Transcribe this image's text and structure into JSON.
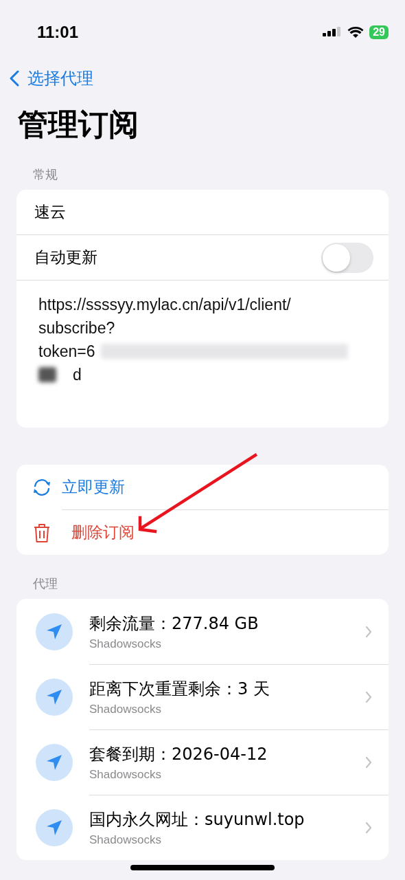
{
  "status_bar": {
    "time": "11:01",
    "battery": "29"
  },
  "nav": {
    "back_label": "选择代理",
    "title": "管理订阅"
  },
  "general": {
    "header": "常规",
    "name": "速云",
    "auto_update": {
      "label": "自动更新",
      "on": false
    },
    "url_lines": [
      {
        "text": "https://ssssyy.mylac.cn/api/v1/client/"
      },
      {
        "text": "subscribe?"
      },
      {
        "text": "token=6",
        "redacted_after": true
      },
      {
        "text": "d",
        "redacted_before": true
      }
    ]
  },
  "actions": [
    {
      "kind": "refresh",
      "label": "立即更新"
    },
    {
      "kind": "delete",
      "label": "删除订阅"
    }
  ],
  "annotation": {
    "kind": "arrow",
    "color": "#e8141e"
  },
  "proxies": {
    "header": "代理",
    "items": [
      {
        "title": "剩余流量：277.84 GB",
        "subtitle": "Shadowsocks"
      },
      {
        "title": "距离下次重置剩余：3 天",
        "subtitle": "Shadowsocks"
      },
      {
        "title": "套餐到期：2026-04-12",
        "subtitle": "Shadowsocks"
      },
      {
        "title": "国内永久网址：suyunwl.top",
        "subtitle": "Shadowsocks"
      }
    ]
  }
}
